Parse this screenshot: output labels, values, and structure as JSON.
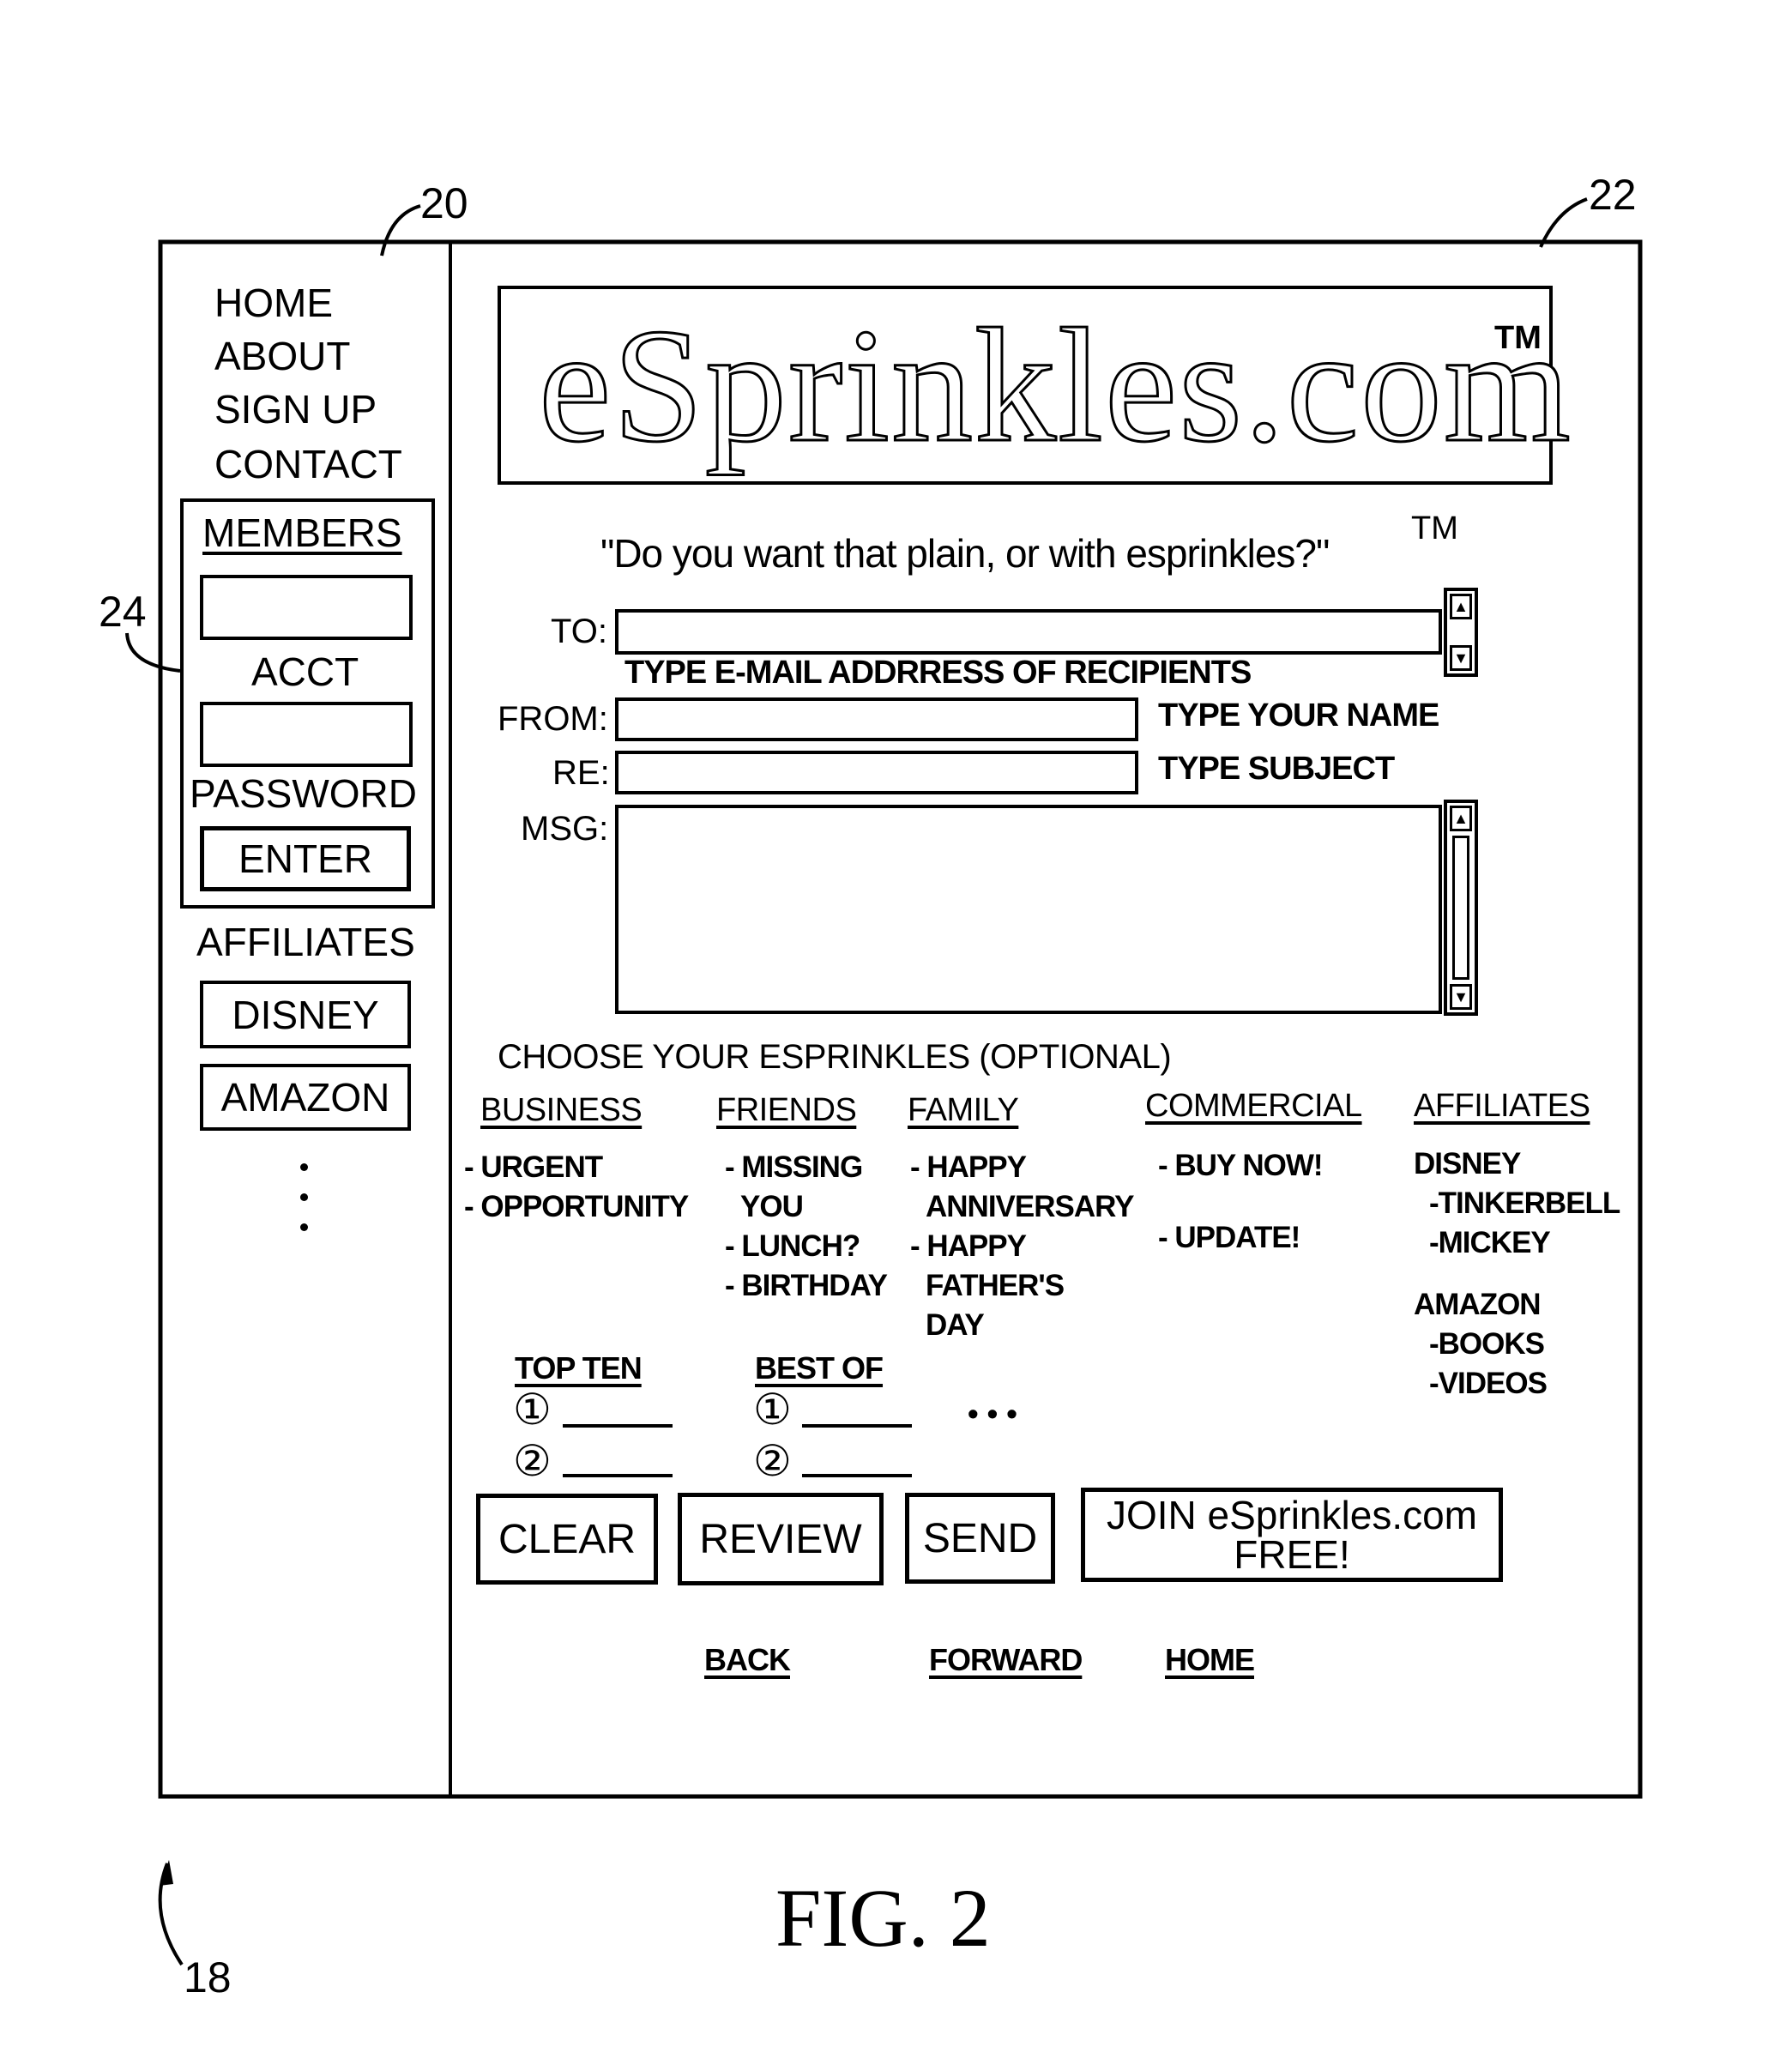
{
  "figure": {
    "caption": "FIG. 2",
    "refs": {
      "page": "18",
      "nav_panel": "20",
      "content_panel": "22",
      "members_box": "24"
    }
  },
  "sidebar": {
    "nav": [
      "HOME",
      "ABOUT",
      "SIGN UP",
      "CONTACT"
    ],
    "members": {
      "title": "MEMBERS",
      "acct_label": "ACCT",
      "acct_value": "",
      "password_label": "PASSWORD",
      "password_value": "",
      "enter_label": "ENTER"
    },
    "affiliates_title": "AFFILIATES",
    "affiliates": [
      "DISNEY",
      "AMAZON"
    ],
    "more_icon": "vertical-ellipsis"
  },
  "header": {
    "logo": "eSprinkles.com",
    "logo_tm": "TM",
    "slogan": "\"Do you want that plain, or with esprinkles?\"",
    "slogan_tm": "TM"
  },
  "form": {
    "to": {
      "label": "TO:",
      "value": "",
      "hint": "TYPE E-MAIL ADDRRESS OF RECIPIENTS"
    },
    "from": {
      "label": "FROM:",
      "value": "",
      "hint": "TYPE YOUR NAME"
    },
    "re": {
      "label": "RE:",
      "value": "",
      "hint": "TYPE SUBJECT"
    },
    "msg": {
      "label": "MSG:",
      "value": ""
    }
  },
  "choose": {
    "title": "CHOOSE YOUR ESPRINKLES (OPTIONAL)",
    "categories": [
      {
        "name": "BUSINESS",
        "items": [
          "- URGENT",
          "- OPPORTUNITY"
        ]
      },
      {
        "name": "FRIENDS",
        "items": [
          "- MISSING",
          "YOU",
          "- LUNCH?",
          "- BIRTHDAY"
        ]
      },
      {
        "name": "FAMILY",
        "items": [
          "- HAPPY",
          "ANNIVERSARY",
          "- HAPPY",
          "FATHER'S",
          "DAY"
        ]
      },
      {
        "name": "COMMERCIAL",
        "items": [
          "- BUY NOW!",
          "- UPDATE!"
        ]
      },
      {
        "name": "AFFILIATES",
        "items": [
          "DISNEY",
          "-TINKERBELL",
          "-MICKEY",
          "AMAZON",
          "-BOOKS",
          "-VIDEOS"
        ]
      }
    ],
    "lists": [
      {
        "name": "TOP TEN",
        "entries": [
          "①",
          "②"
        ]
      },
      {
        "name": "BEST OF",
        "entries": [
          "①",
          "②"
        ]
      }
    ],
    "more": "• • •"
  },
  "actions": {
    "clear": "CLEAR",
    "review": "REVIEW",
    "send": "SEND",
    "join_line1": "JOIN eSprinkles.com",
    "join_line2": "FREE!"
  },
  "footer_nav": {
    "back": "BACK",
    "forward": "FORWARD",
    "home": "HOME"
  }
}
